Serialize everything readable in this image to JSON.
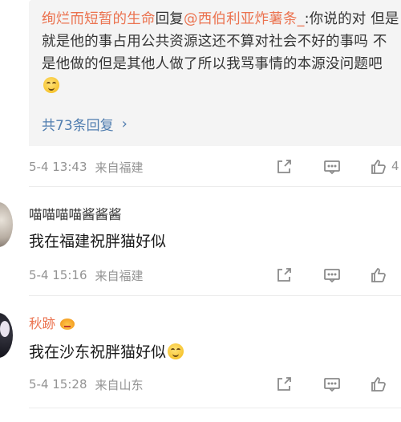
{
  "reply_preview": {
    "author_left": "绚烂而短暂的生命",
    "reply_word": "回复",
    "mention": "@西伯利亚炸薯条_",
    "text": ":你说的对 但是就是他的事占用公共资源这还不算对社会不好的事吗 不是他做的但是其他人做了所以我骂事情的本源没问题吧",
    "emoji_name": "laugh-cry-emoji",
    "more_label": "共73条回复",
    "more_icon": "chevron-right-icon"
  },
  "comments": [
    {
      "time": "5-4 13:43",
      "location": "来自福建",
      "icons": [
        "share-icon",
        "comment-icon",
        "like-icon"
      ],
      "like_count": "4"
    },
    {
      "username": "喵喵喵喵酱酱酱",
      "text": "我在福建祝胖猫好似",
      "time": "5-4 15:16",
      "location": "来自福建",
      "icons": [
        "share-icon",
        "comment-icon",
        "like-icon"
      ]
    },
    {
      "username": "秋跡",
      "badge": "vip-crown-icon",
      "text": "我在沙东祝胖猫好似",
      "text_emoji": "smile-emoji",
      "time": "5-4 15:28",
      "location": "来自山东",
      "icons": [
        "share-icon",
        "comment-icon",
        "like-icon"
      ]
    }
  ],
  "colors": {
    "link": "#eb7350",
    "blue": "#507daf",
    "meta": "#939393",
    "reply_bg": "#f4f4f4"
  }
}
